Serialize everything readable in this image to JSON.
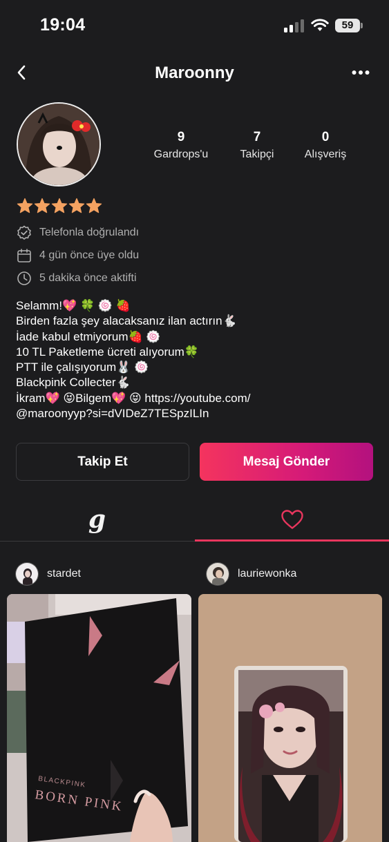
{
  "status_bar": {
    "time": "19:04",
    "battery": "59",
    "icons": [
      "cellular-signal-icon",
      "wifi-icon",
      "battery-icon"
    ]
  },
  "nav": {
    "title": "Maroonny",
    "back_icon": "chevron-left-icon",
    "more_icon": "more-horizontal-icon"
  },
  "profile": {
    "rating_stars": 5,
    "stats": [
      {
        "value": "9",
        "label": "Gardrops'u"
      },
      {
        "value": "7",
        "label": "Takipçi"
      },
      {
        "value": "0",
        "label": "Alışveriş"
      }
    ],
    "info": [
      {
        "icon": "verified-badge-icon",
        "text": "Telefonla doğrulandı"
      },
      {
        "icon": "calendar-icon",
        "text": "4 gün önce üye oldu"
      },
      {
        "icon": "clock-icon",
        "text": "5 dakika önce aktifti"
      }
    ],
    "bio": [
      "Selamm!💖 🍀 🍥 🍓",
      "Birden fazla şey alacaksanız ilan actırın🐇",
      "İade kabul etmiyorum🍓 🍥",
      " 10 TL Paketleme ücreti alıyorum🍀",
      "PTT ile çalışıyorum🐰 🍥",
      "Blackpink Collecter🐇",
      "İkram💖 😝Bilgem💖 😝 https://youtube.com/",
      "@maroonyyp?si=dVIDeZ7TESpzILIn"
    ]
  },
  "actions": {
    "follow_label": "Takip Et",
    "message_label": "Mesaj Gönder"
  },
  "tabs": {
    "wardrobe_label": "g",
    "favorites_icon": "heart-icon",
    "active": "favorites"
  },
  "colors": {
    "background": "#1c1c1e",
    "accent": "#e9365e",
    "star": "#f4a261",
    "button_gradient_start": "#f4345e",
    "button_gradient_end": "#b3117e"
  },
  "items": [
    {
      "username": "stardet",
      "image_text_top": "BLACKPINK",
      "image_text_bottom": "BORN PINK"
    },
    {
      "username": "lauriewonka"
    }
  ]
}
